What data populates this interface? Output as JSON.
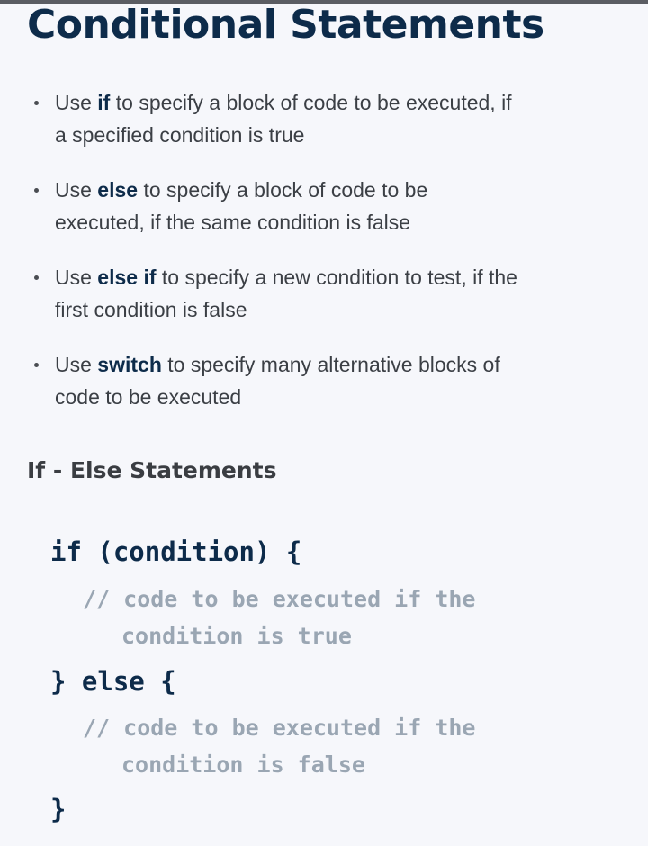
{
  "title": "Conditional Statements",
  "bullets": [
    {
      "prefix": "Use ",
      "keyword": "if",
      "line1_rest": " to specify a block of code to be executed, if",
      "line2": "a specified condition is true"
    },
    {
      "prefix": "Use ",
      "keyword": "else",
      "line1_rest": " to specify a block of code to be",
      "line2": "executed, if the same condition is false"
    },
    {
      "prefix": "Use ",
      "keyword": "else if",
      "line1_rest": " to specify a new condition to test, if the",
      "line2": "first condition is false"
    },
    {
      "prefix": "Use ",
      "keyword": "switch",
      "line1_rest": " to specify many alternative blocks of",
      "line2": "code to be executed"
    }
  ],
  "subtitle": "If - Else Statements",
  "code": {
    "line_if": "if (condition) {",
    "comment_if_1": "// code to be executed if the",
    "comment_if_2": "condition is true",
    "line_else": "} else {",
    "comment_else_1": "// code to be executed if the",
    "comment_else_2": "condition is false",
    "line_close": "}"
  }
}
